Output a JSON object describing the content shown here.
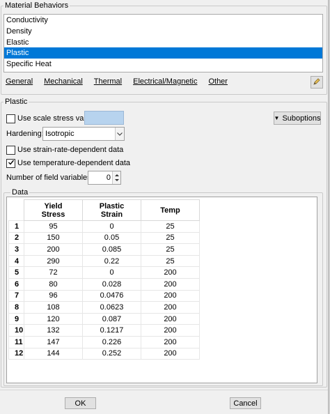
{
  "material_behaviors": {
    "title": "Material Behaviors",
    "items": [
      "Conductivity",
      "Density",
      "Elastic",
      "Plastic",
      "Specific Heat"
    ],
    "selected": "Plastic"
  },
  "menus": [
    "General",
    "Mechanical",
    "Thermal",
    "Electrical/Magnetic",
    "Other"
  ],
  "plastic": {
    "title": "Plastic",
    "scale_stress_label": "Use scale stress value:",
    "scale_stress_value": "",
    "suboptions_label": "Suboptions",
    "hardening_label": "Hardening:",
    "hardening_value": "Isotropic",
    "strain_rate_label": "Use strain-rate-dependent data",
    "temperature_label": "Use temperature-dependent data",
    "field_vars_label": "Number of field variables:",
    "field_vars_value": "0"
  },
  "data_table": {
    "title": "Data",
    "headers": [
      {
        "line1": "Yield",
        "line2": "Stress"
      },
      {
        "line1": "Plastic",
        "line2": "Strain"
      },
      {
        "line1": "Temp",
        "line2": ""
      }
    ],
    "rows": [
      {
        "n": "1",
        "yield": "95",
        "strain": "0",
        "temp": "25"
      },
      {
        "n": "2",
        "yield": "150",
        "strain": "0.05",
        "temp": "25"
      },
      {
        "n": "3",
        "yield": "200",
        "strain": "0.085",
        "temp": "25"
      },
      {
        "n": "4",
        "yield": "290",
        "strain": "0.22",
        "temp": "25"
      },
      {
        "n": "5",
        "yield": "72",
        "strain": "0",
        "temp": "200"
      },
      {
        "n": "6",
        "yield": "80",
        "strain": "0.028",
        "temp": "200"
      },
      {
        "n": "7",
        "yield": "96",
        "strain": "0.0476",
        "temp": "200"
      },
      {
        "n": "8",
        "yield": "108",
        "strain": "0.0623",
        "temp": "200"
      },
      {
        "n": "9",
        "yield": "120",
        "strain": "0.087",
        "temp": "200"
      },
      {
        "n": "10",
        "yield": "132",
        "strain": "0.1217",
        "temp": "200"
      },
      {
        "n": "11",
        "yield": "147",
        "strain": "0.226",
        "temp": "200"
      },
      {
        "n": "12",
        "yield": "144",
        "strain": "0.252",
        "temp": "200"
      }
    ]
  },
  "buttons": {
    "ok": "OK",
    "cancel": "Cancel"
  },
  "colors": {
    "selection": "#0078d7",
    "scale_input_fill": "#b7d3ee"
  }
}
